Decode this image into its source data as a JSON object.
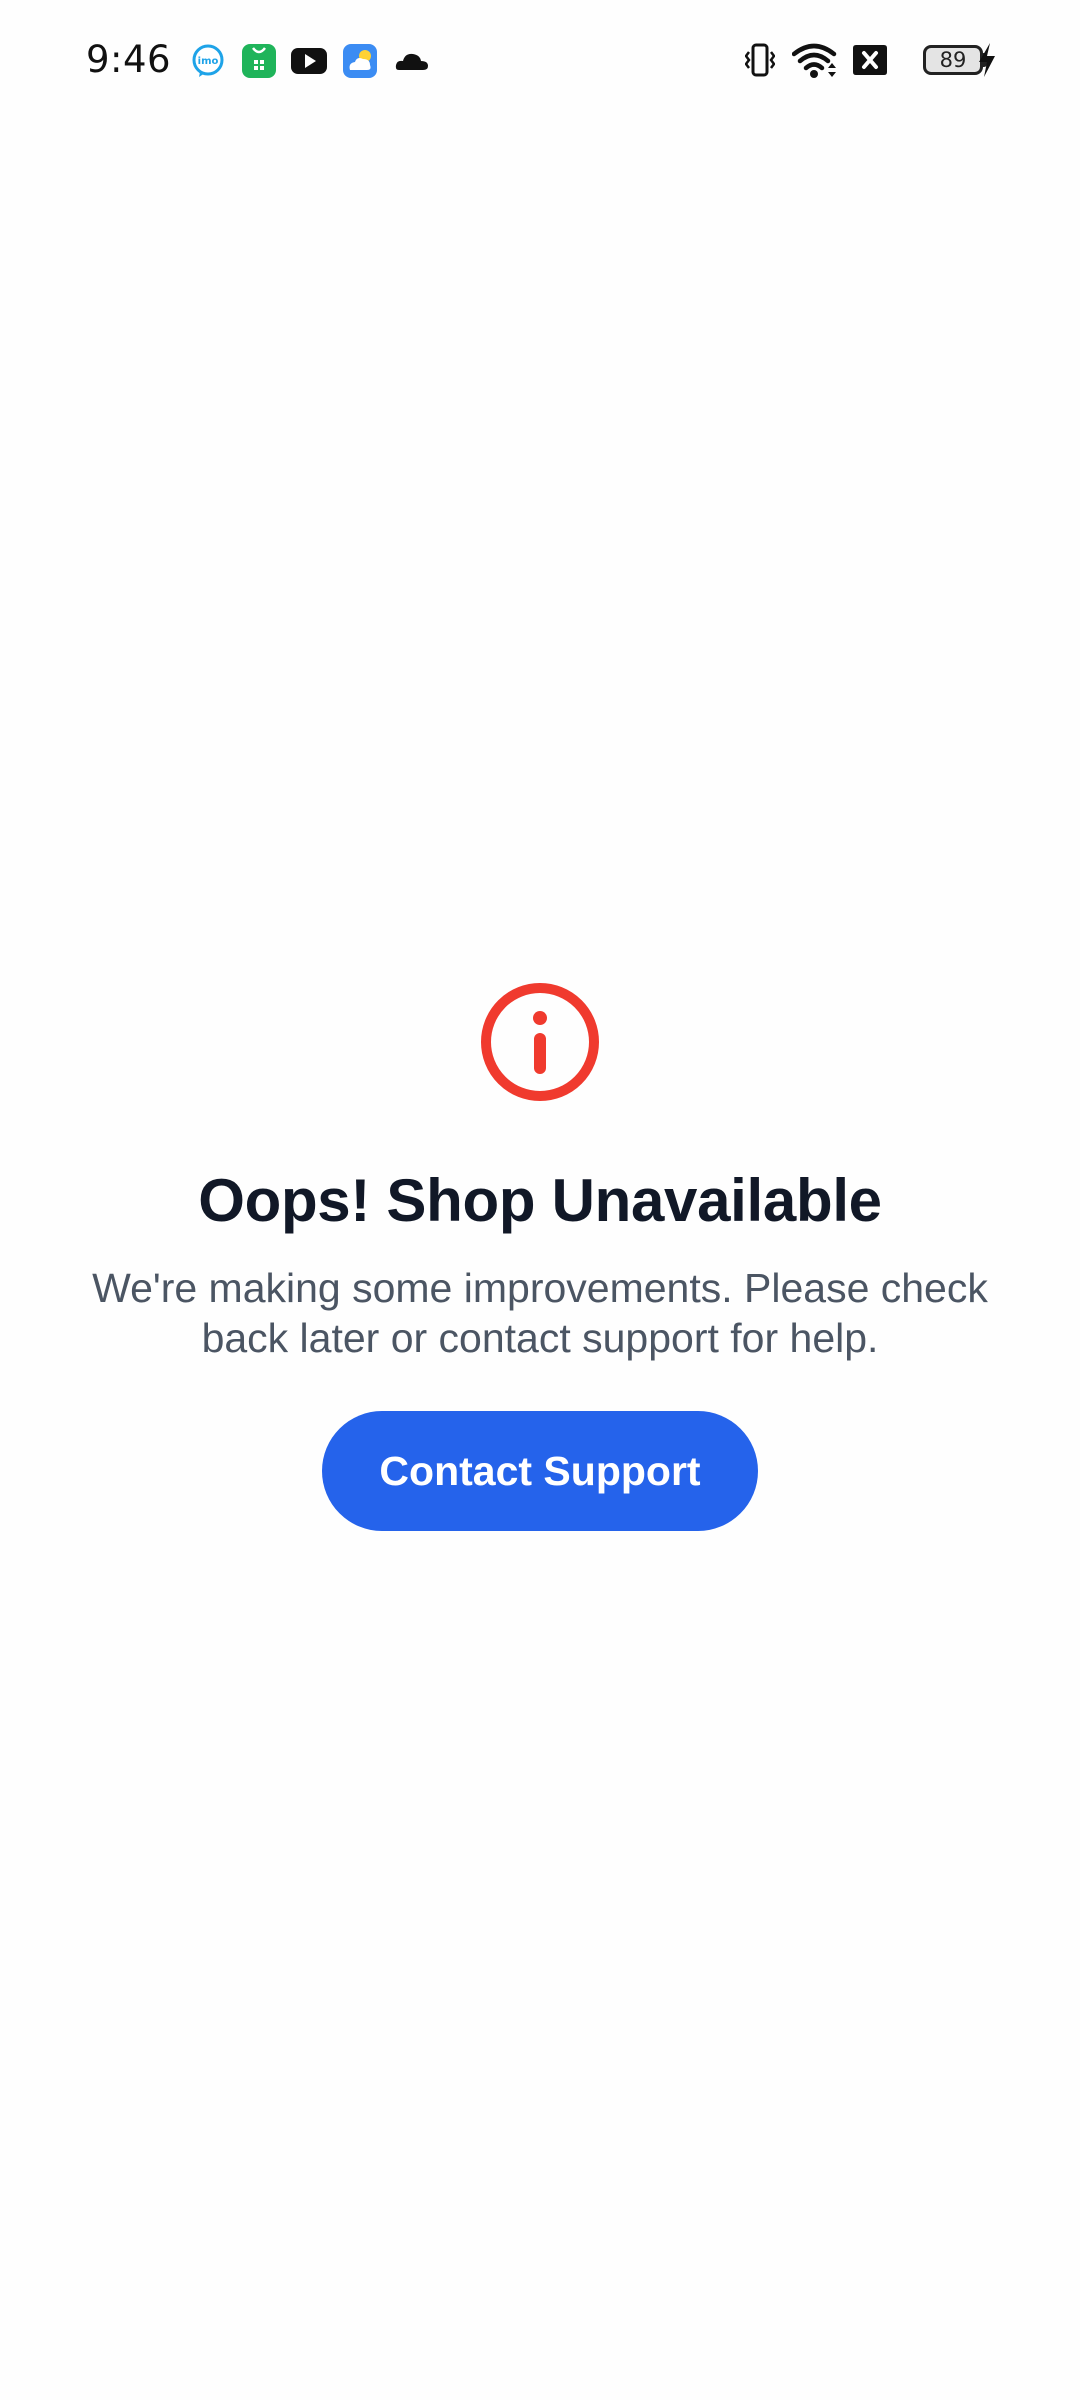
{
  "status_bar": {
    "time": "9:46",
    "battery_level": "89",
    "notification_icons": [
      "imo-icon",
      "app-store-icon",
      "youtube-icon",
      "weather-icon",
      "cloud-icon"
    ],
    "system_icons": [
      "vibrate-icon",
      "wifi-icon",
      "no-sim-icon",
      "battery-icon",
      "charging-icon"
    ]
  },
  "error_state": {
    "icon": "info-alert-icon",
    "title": "Oops! Shop Unavailable",
    "message": "We're making some improvements. Please check back later or contact support for help.",
    "button_label": "Contact Support"
  },
  "colors": {
    "alert_red": "#f03a2e",
    "primary_blue": "#2563eb",
    "title_text": "#111827",
    "body_text": "#4b5563",
    "background": "#fefefe"
  }
}
